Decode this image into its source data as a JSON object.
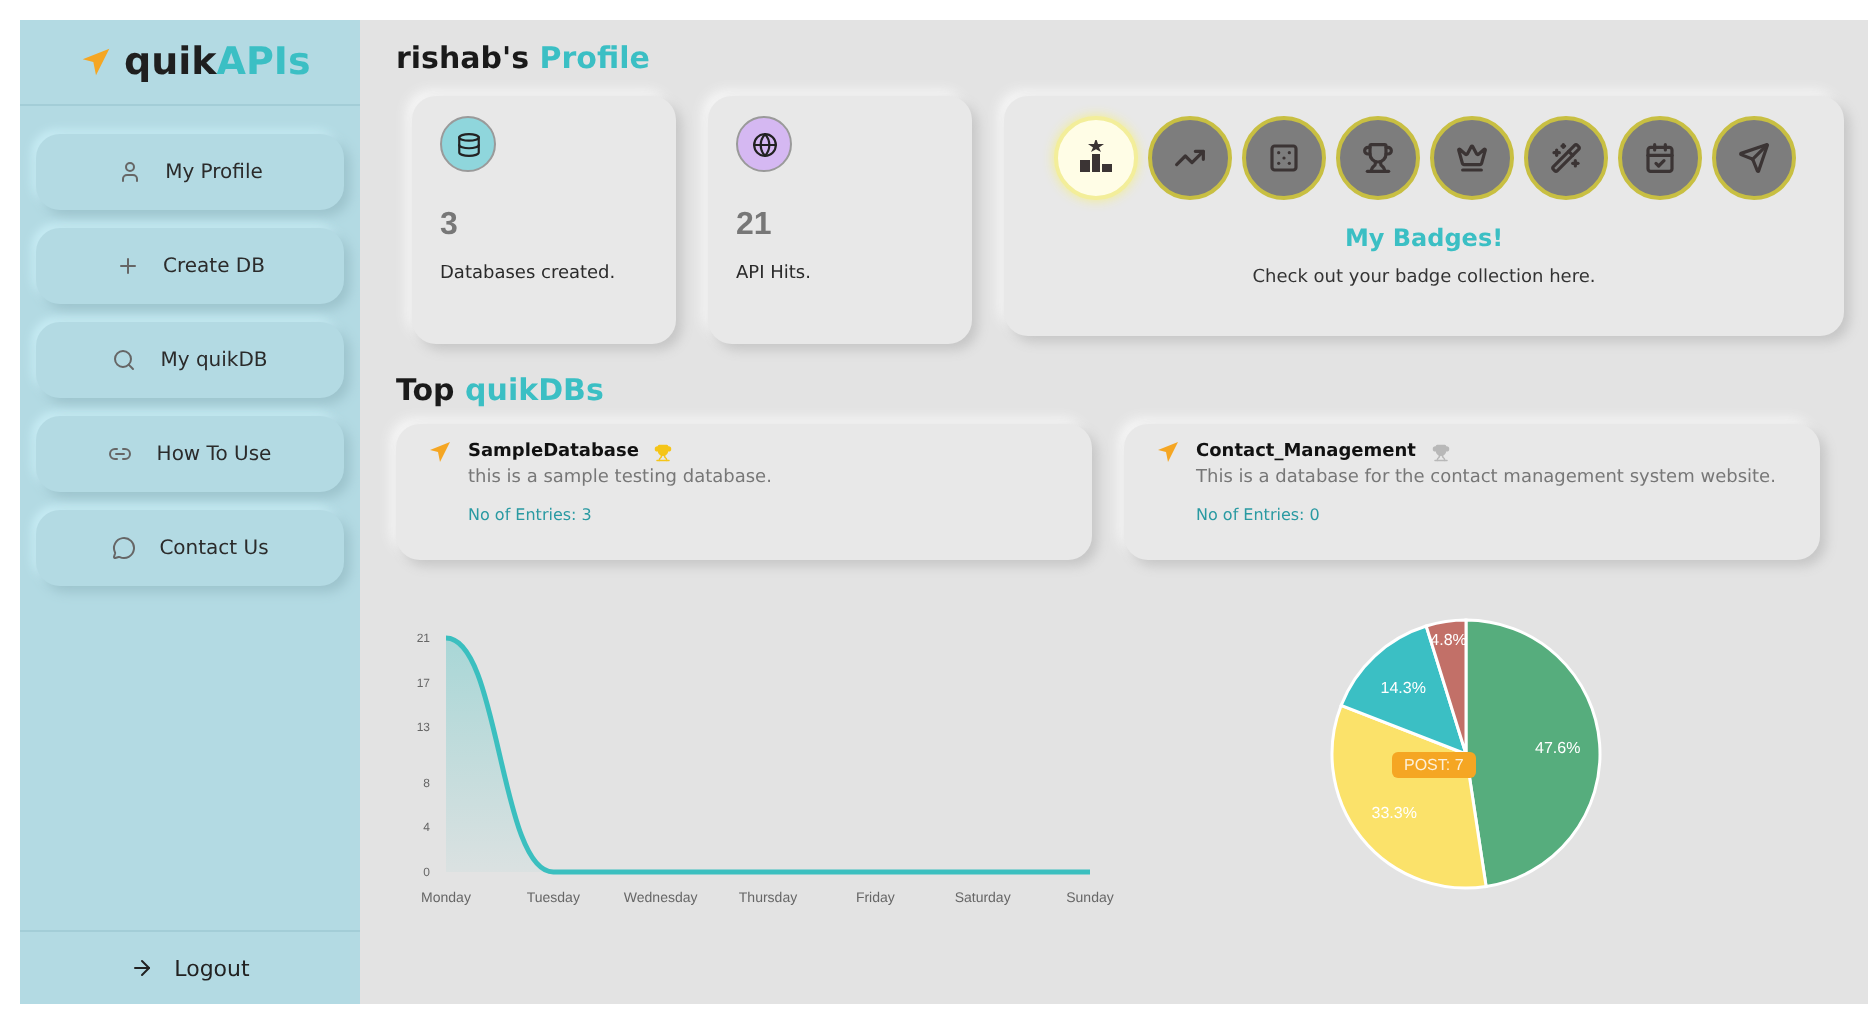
{
  "sidebar": {
    "logo": {
      "prefix": "quik",
      "suffix": "APIs"
    },
    "items": [
      {
        "label": "My Profile"
      },
      {
        "label": "Create DB"
      },
      {
        "label": "My quikDB"
      },
      {
        "label": "How To Use"
      },
      {
        "label": "Contact Us"
      }
    ],
    "logout": "Logout"
  },
  "profile": {
    "user": "rishab's",
    "title": "Profile"
  },
  "stats": [
    {
      "value": "3",
      "label": "Databases created.",
      "color": "#8fd6dc"
    },
    {
      "value": "21",
      "label": "API Hits.",
      "color": "#d5b8f2"
    }
  ],
  "badges": {
    "items": [
      {
        "earned": true
      },
      {
        "earned": false
      },
      {
        "earned": false
      },
      {
        "earned": false
      },
      {
        "earned": false
      },
      {
        "earned": false
      },
      {
        "earned": false
      },
      {
        "earned": false
      }
    ],
    "title": "My Badges!",
    "subtitle": "Check out your badge collection here."
  },
  "top_dbs": {
    "title_prefix": "Top",
    "title_accent": "quikDBs",
    "items": [
      {
        "name": "SampleDatabase",
        "awarded": true,
        "description": "this is a sample testing database.",
        "entries": "No of Entries: 3"
      },
      {
        "name": "Contact_Management",
        "awarded": false,
        "description": "This is a database for the contact management system website.",
        "entries": "No of Entries: 0"
      }
    ]
  },
  "line_chart": {
    "chart_data": {
      "type": "area",
      "categories": [
        "Monday",
        "Tuesday",
        "Wednesday",
        "Thursday",
        "Friday",
        "Saturday",
        "Sunday"
      ],
      "series": [
        {
          "color": "#3bbfbf",
          "values": [
            21,
            0,
            0,
            0,
            0,
            0,
            0
          ]
        }
      ],
      "ylim": [
        0,
        21
      ],
      "yticks": [
        0,
        4,
        8,
        13,
        17,
        21
      ]
    }
  },
  "pie_chart": {
    "chart_data": {
      "type": "pie",
      "series": [
        {
          "values": [
            47.6,
            33.3,
            14.3,
            4.8
          ]
        }
      ],
      "colors": [
        "#56ad7d",
        "#fbe26a",
        "#3bbfc4",
        "#c27068"
      ],
      "value_labels": [
        "47.6%",
        "33.3%",
        "14.3%",
        "4.8%"
      ],
      "annotations": [
        "POST: 7"
      ]
    }
  }
}
